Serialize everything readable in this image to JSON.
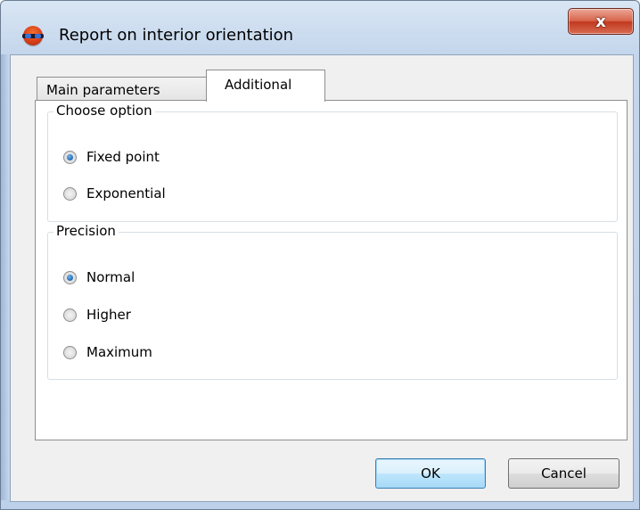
{
  "window": {
    "title": "Report on interior orientation",
    "close_label": "x",
    "app_icon": "stereo-glasses-icon",
    "accent_color": "#c1391f"
  },
  "tabs": [
    {
      "label": "Main parameters",
      "selected": false
    },
    {
      "label": "Additional",
      "selected": true
    }
  ],
  "groups": {
    "choose_option": {
      "legend": "Choose option",
      "options": [
        {
          "label": "Fixed point",
          "checked": true
        },
        {
          "label": "Exponential",
          "checked": false
        }
      ]
    },
    "precision": {
      "legend": "Precision",
      "options": [
        {
          "label": "Normal",
          "checked": true
        },
        {
          "label": "Higher",
          "checked": false
        },
        {
          "label": "Maximum",
          "checked": false
        }
      ]
    }
  },
  "buttons": {
    "ok_label": "OK",
    "cancel_label": "Cancel"
  }
}
